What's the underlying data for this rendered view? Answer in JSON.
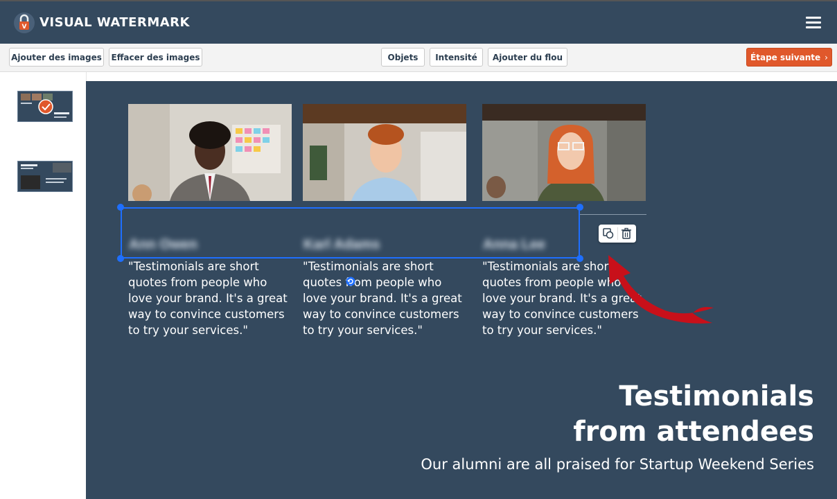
{
  "header": {
    "title": "VISUAL WATERMARK"
  },
  "toolbar": {
    "add_images": "Ajouter des images",
    "clear_images": "Effacer des images",
    "objects": "Objets",
    "intensity": "Intensité",
    "add_blur": "Ajouter du flou",
    "next_step": "Étape suivante",
    "next_chevron": "›"
  },
  "sidebar": {
    "thumbnails": [
      {
        "selected": true
      },
      {
        "label": "About Startup Weekend"
      }
    ]
  },
  "slide": {
    "people": [
      {
        "name_blurred": "Ann Owen",
        "quote": "\"Testimonials are short quotes from people who love your brand. It's a great way to convince customers to try your services.\""
      },
      {
        "name_blurred": "Karl Adams",
        "quote": "\"Testimonials are short quotes from people who love your brand. It's a great way to convince customers to try your services.\""
      },
      {
        "name_blurred": "Anna Lee",
        "quote": "\"Testimonials are short quotes from people who love your brand. It's a great way to convince customers to try your services.\""
      }
    ],
    "heading_line1": "Testimonials",
    "heading_line2": "from attendees",
    "subheading": "Our alumni are all praised for Startup Weekend Series"
  },
  "icons": {
    "logo": "lock-shield-icon",
    "menu": "hamburger-menu-icon",
    "duplicate": "duplicate-icon",
    "delete": "trash-icon",
    "rotate": "rotate-icon",
    "annotation": "red-curved-arrow"
  },
  "colors": {
    "header_bg": "#34495e",
    "accent": "#e0582b",
    "selection": "#1e6fff",
    "canvas_bg": "#34495e"
  }
}
